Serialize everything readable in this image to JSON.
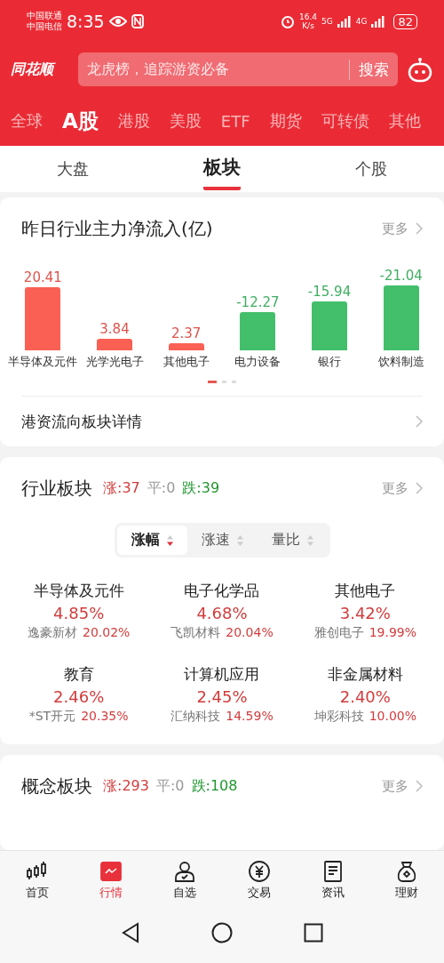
{
  "status_bar": {
    "carriers": [
      "中国联通",
      "中国电信"
    ],
    "time": "8:35",
    "speed": "16.4",
    "speed_unit": "K/s",
    "networks": [
      "5G",
      "4G"
    ],
    "battery": "82"
  },
  "header": {
    "logo": "同花顺",
    "search": {
      "placeholder": "龙虎榜，追踪游资必备",
      "button": "搜索"
    }
  },
  "market_tabs": [
    {
      "label": "全球",
      "selected": false
    },
    {
      "label": "A股",
      "selected": true
    },
    {
      "label": "港股",
      "selected": false
    },
    {
      "label": "美股",
      "selected": false
    },
    {
      "label": "ETF",
      "selected": false
    },
    {
      "label": "期货",
      "selected": false
    },
    {
      "label": "可转债",
      "selected": false
    },
    {
      "label": "其他",
      "selected": false
    }
  ],
  "sub_tabs": [
    {
      "label": "大盘",
      "selected": false
    },
    {
      "label": "板块",
      "selected": true
    },
    {
      "label": "个股",
      "selected": false
    }
  ],
  "flow_card": {
    "title": "昨日行业主力净流入(亿)",
    "more": "更多",
    "flows": [
      {
        "name": "半导体及元件",
        "value": "20.41",
        "kind": "inflow"
      },
      {
        "name": "光学光电子",
        "value": "3.84",
        "kind": "inflow"
      },
      {
        "name": "其他电子",
        "value": "2.37",
        "kind": "inflow"
      },
      {
        "name": "电力设备",
        "value": "-12.27",
        "kind": "outflow"
      },
      {
        "name": "银行",
        "value": "-15.94",
        "kind": "outflow"
      },
      {
        "name": "饮料制造",
        "value": "-21.04",
        "kind": "outflow"
      }
    ],
    "pages": [
      {
        "selected": true
      },
      {
        "selected": false
      },
      {
        "selected": false
      }
    ],
    "link": "港资流向板块详情"
  },
  "industry_card": {
    "title": "行业板块",
    "up": "涨:37",
    "flat": "平:0",
    "down": "跌:39",
    "more": "更多",
    "sort_tabs": [
      {
        "label": "涨幅",
        "selected": true
      },
      {
        "label": "涨速",
        "selected": false
      },
      {
        "label": "量比",
        "selected": false
      }
    ],
    "sectors": [
      {
        "name": "半导体及元件",
        "change": "4.85%",
        "stock": "逸豪新材",
        "stock_change": "20.02%"
      },
      {
        "name": "电子化学品",
        "change": "4.68%",
        "stock": "飞凯材料",
        "stock_change": "20.04%"
      },
      {
        "name": "其他电子",
        "change": "3.42%",
        "stock": "雅创电子",
        "stock_change": "19.99%"
      },
      {
        "name": "教育",
        "change": "2.46%",
        "stock": "*ST开元",
        "stock_change": "20.35%"
      },
      {
        "name": "计算机应用",
        "change": "2.45%",
        "stock": "汇纳科技",
        "stock_change": "14.59%"
      },
      {
        "name": "非金属材料",
        "change": "2.40%",
        "stock": "坤彩科技",
        "stock_change": "10.00%"
      }
    ]
  },
  "concept_card": {
    "title": "概念板块",
    "up": "涨:293",
    "flat": "平:0",
    "down": "跌:108",
    "more": "更多"
  },
  "bottom_nav": [
    {
      "label": "首页",
      "kind": "candles",
      "selected": false
    },
    {
      "label": "行情",
      "kind": "chart",
      "selected": true
    },
    {
      "label": "自选",
      "kind": "person",
      "selected": false
    },
    {
      "label": "交易",
      "kind": "yen",
      "selected": false
    },
    {
      "label": "资讯",
      "kind": "doc",
      "selected": false
    },
    {
      "label": "理财",
      "kind": "bag",
      "selected": false
    }
  ]
}
